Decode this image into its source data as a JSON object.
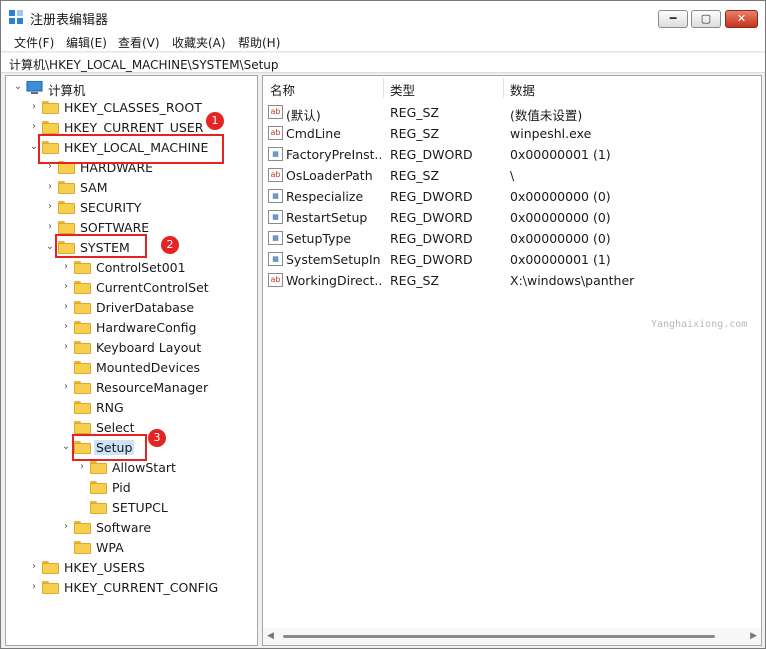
{
  "window": {
    "title": "注册表编辑器",
    "buttons": {
      "minimize": "━",
      "maximize": "▢",
      "close": "✕"
    }
  },
  "menu": [
    "文件(F)",
    "编辑(E)",
    "查看(V)",
    "收藏夹(A)",
    "帮助(H)"
  ],
  "address": "计算机\\HKEY_LOCAL_MACHINE\\SYSTEM\\Setup",
  "tree": {
    "root": "计算机",
    "items": [
      {
        "label": "HKEY_CLASSES_ROOT"
      },
      {
        "label": "HKEY_CURRENT_USER"
      },
      {
        "label": "HKEY_LOCAL_MACHINE"
      },
      {
        "label": "HARDWARE"
      },
      {
        "label": "SAM"
      },
      {
        "label": "SECURITY"
      },
      {
        "label": "SOFTWARE"
      },
      {
        "label": "SYSTEM"
      },
      {
        "label": "ControlSet001"
      },
      {
        "label": "CurrentControlSet"
      },
      {
        "label": "DriverDatabase"
      },
      {
        "label": "HardwareConfig"
      },
      {
        "label": "Keyboard Layout"
      },
      {
        "label": "MountedDevices"
      },
      {
        "label": "ResourceManager"
      },
      {
        "label": "RNG"
      },
      {
        "label": "Select"
      },
      {
        "label": "Setup"
      },
      {
        "label": "AllowStart"
      },
      {
        "label": "Pid"
      },
      {
        "label": "SETUPCL"
      },
      {
        "label": "Software"
      },
      {
        "label": "WPA"
      },
      {
        "label": "HKEY_USERS"
      },
      {
        "label": "HKEY_CURRENT_CONFIG"
      }
    ],
    "selected": "Setup"
  },
  "annotations": [
    "1",
    "2",
    "3"
  ],
  "list": {
    "headers": {
      "name": "名称",
      "type": "类型",
      "data": "数据"
    },
    "rows": [
      {
        "name": "(默认)",
        "type": "REG_SZ",
        "data": "(数值未设置)",
        "icon": "string-value-icon"
      },
      {
        "name": "CmdLine",
        "type": "REG_SZ",
        "data": "winpeshl.exe",
        "icon": "string-value-icon"
      },
      {
        "name": "FactoryPreInst...",
        "type": "REG_DWORD",
        "data": "0x00000001 (1)",
        "icon": "dword-value-icon"
      },
      {
        "name": "OsLoaderPath",
        "type": "REG_SZ",
        "data": "\\",
        "icon": "string-value-icon"
      },
      {
        "name": "Respecialize",
        "type": "REG_DWORD",
        "data": "0x00000000 (0)",
        "icon": "dword-value-icon"
      },
      {
        "name": "RestartSetup",
        "type": "REG_DWORD",
        "data": "0x00000000 (0)",
        "icon": "dword-value-icon"
      },
      {
        "name": "SetupType",
        "type": "REG_DWORD",
        "data": "0x00000000 (0)",
        "icon": "dword-value-icon"
      },
      {
        "name": "SystemSetupIn...",
        "type": "REG_DWORD",
        "data": "0x00000001 (1)",
        "icon": "dword-value-icon"
      },
      {
        "name": "WorkingDirect...",
        "type": "REG_SZ",
        "data": "X:\\windows\\panther",
        "icon": "string-value-icon"
      }
    ]
  },
  "watermark": "Yanghaixiong.com",
  "icon_glyphs": {
    "string": "ab",
    "dword": "011\n110"
  },
  "colors": {
    "annotation_red": "#e52323",
    "selection": "#cce4f7",
    "folder": "#f6cf4e"
  }
}
